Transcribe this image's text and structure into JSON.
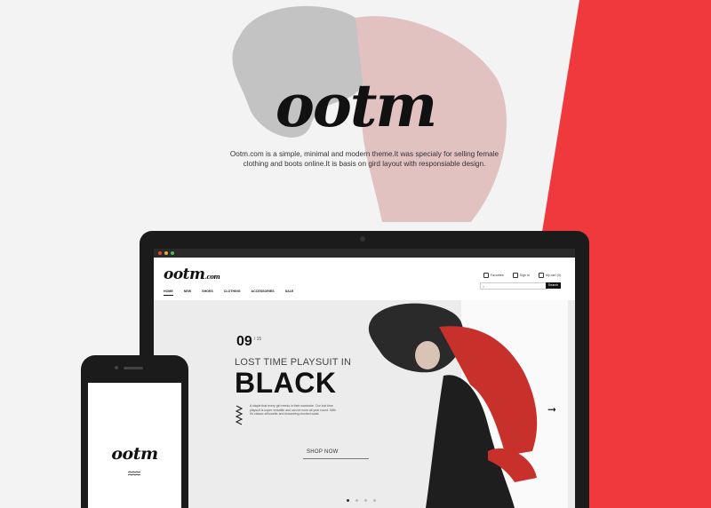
{
  "hero": {
    "logo": "ootm",
    "tagline": "Ootm.com is a simple, minimal and modern theme.It was specialy for selling female clothing and boots online.It is basis on gird layout with responsiable design."
  },
  "colors": {
    "accent": "#f0393d",
    "dark": "#1b1b1b"
  },
  "site": {
    "logo": "ootm",
    "logo_suffix": ".com",
    "top_links": {
      "favorites": "Favorites",
      "signin": "Sign In",
      "cart": "My cart (0)"
    },
    "search_button": "Search",
    "nav": [
      "HOME",
      "NEW",
      "SHOES",
      "CLOTHING",
      "ACCESSORIES",
      "SALE"
    ]
  },
  "slide": {
    "day": "09",
    "month": "/ 15",
    "subtitle": "LOST TIME PLAYSUIT IN",
    "title": "BLACK",
    "description": "A staple that every girl needs in their wardrobe. Our lost time playsuit is super versatile and can be worn all year round. With it's classic silhouette and drawstring cinched waist.",
    "cta": "SHOP NOW",
    "next_icon": "arrow-right-icon",
    "active_dot": 0
  },
  "phone": {
    "logo": "ootm"
  }
}
